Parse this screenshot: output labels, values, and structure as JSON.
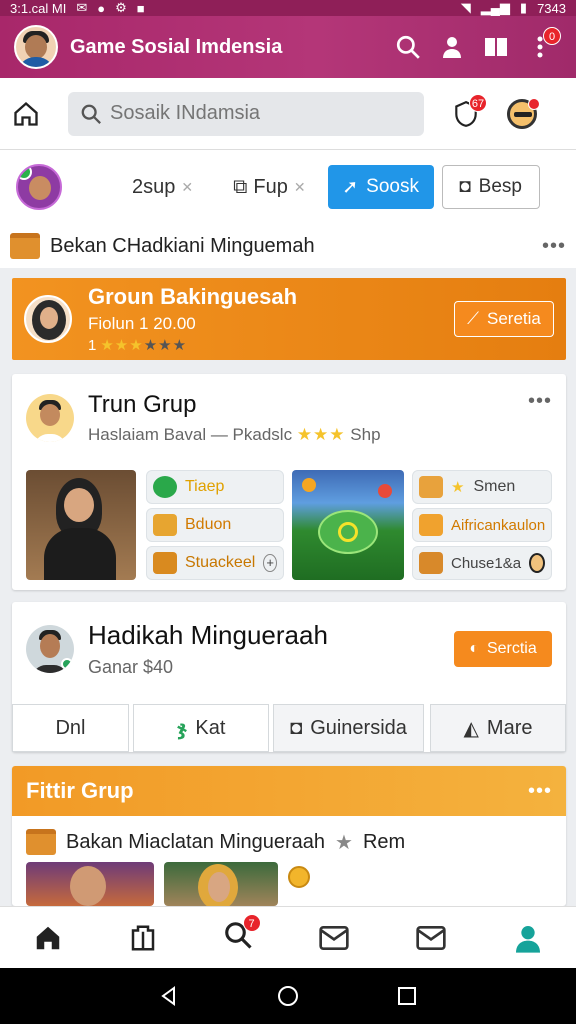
{
  "status_bar": {
    "left": "3:1.cal MI",
    "time": "7343"
  },
  "app_bar": {
    "title": "Game Sosial Imdensia",
    "more_badge": "0"
  },
  "search": {
    "placeholder": "Sosaik INdamsia",
    "shield_badge": "67"
  },
  "filters": {
    "chip1": "2sup",
    "chip2": "Fup",
    "primary_button": "Soosk",
    "secondary_button": "Besp",
    "section_title": "Bekan CHadkiani Minguemah",
    "section_more": "•••"
  },
  "banner": {
    "title": "Groun Bakinguesah",
    "subtitle": "Fiolun 1 20.00",
    "rating": "1",
    "stars": 3,
    "button": "Seretia"
  },
  "group_card": {
    "title": "Trun Grup",
    "subtitle_main": "Haslaiam Baval — Pkadslc",
    "subtitle_tag": "Shp",
    "more": "•••",
    "tiles_left": [
      "Tiaep",
      "Bduon",
      "Stuackeel"
    ],
    "tiles_right": [
      "Smen",
      "Aifricankaulon",
      "Chuse1&a"
    ]
  },
  "profile_card": {
    "name": "Hadikah Mingueraah",
    "meta": "Ganar $40",
    "action_button": "Serctia",
    "tabs": [
      "Dnl",
      "Kat",
      "Guinersida",
      "Mare"
    ]
  },
  "featured": {
    "title": "Fittir Grup",
    "more": "•••",
    "item_title": "Bakan Miaclatan Mingueraah",
    "item_tag": "Rem"
  },
  "bottom_nav": {
    "search_badge": "7"
  },
  "colors": {
    "brand": "#a8276a",
    "accent_orange": "#f08a1e",
    "primary_blue": "#2196e8",
    "green": "#27a35a"
  }
}
